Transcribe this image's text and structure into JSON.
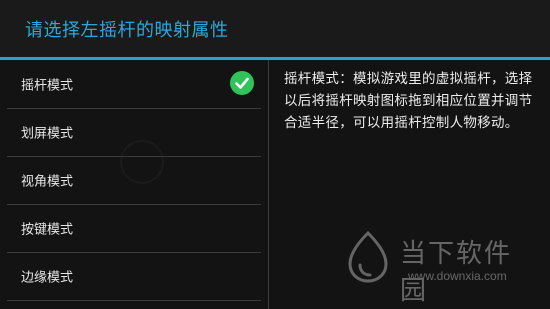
{
  "header": {
    "title": "请选择左摇杆的映射属性"
  },
  "modes": [
    {
      "label": "摇杆模式",
      "selected": true
    },
    {
      "label": "划屏模式",
      "selected": false
    },
    {
      "label": "视角模式",
      "selected": false
    },
    {
      "label": "按键模式",
      "selected": false
    },
    {
      "label": "边缘模式",
      "selected": false
    }
  ],
  "description": {
    "text": "摇杆模式：模拟游戏里的虚拟摇杆，选择以后将摇杆映射图标拖到相应位置并调节合适半径，可以用摇杆控制人物移动。"
  },
  "watermark": {
    "brand": "当下软件园",
    "url": "www.downxia.com"
  },
  "colors": {
    "accent": "#29a9dc",
    "check": "#2fc35a",
    "background": "#131313"
  },
  "icons": {
    "check": "check-circle-icon",
    "watermark_logo": "downxia-logo"
  }
}
